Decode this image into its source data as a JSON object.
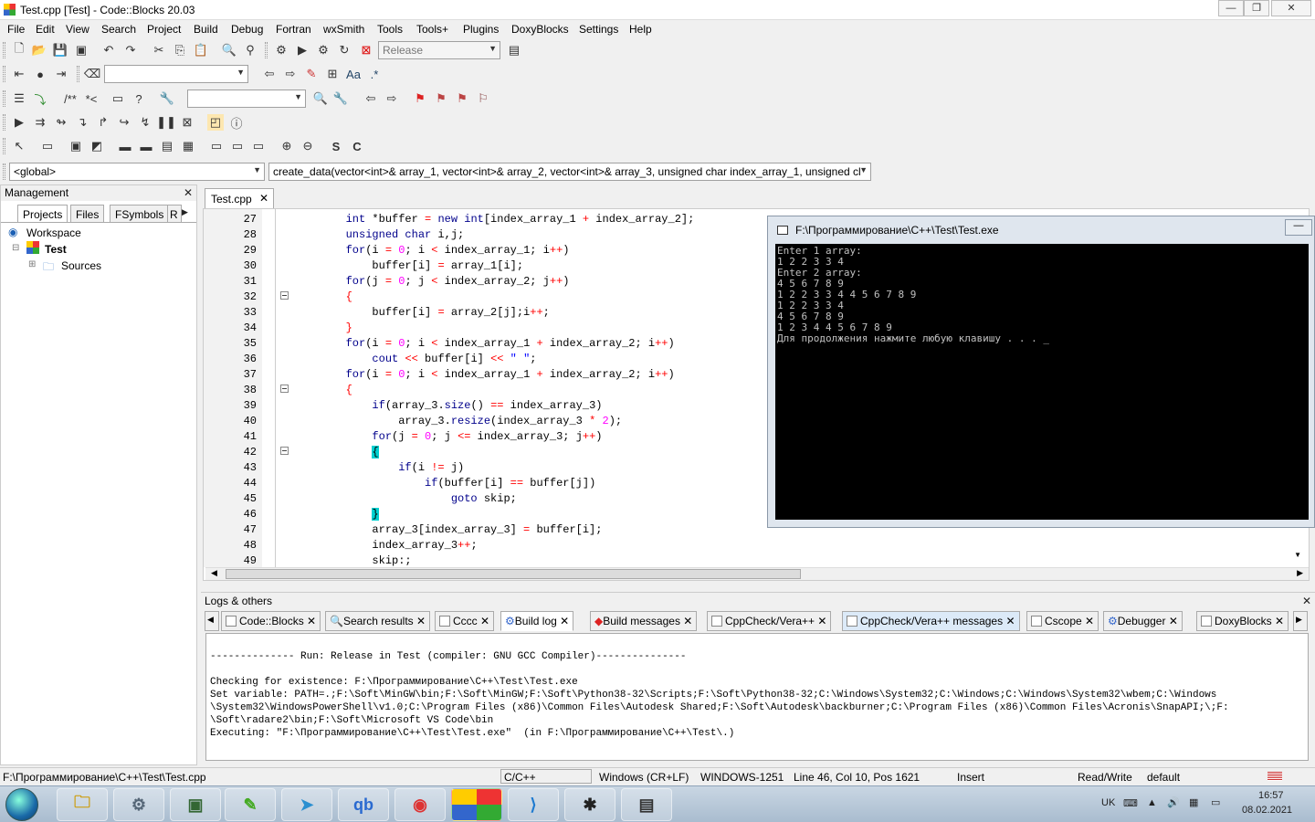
{
  "window": {
    "title": "Test.cpp [Test] - Code::Blocks 20.03",
    "min": "—",
    "max": "❐",
    "close": "✕"
  },
  "menu": [
    "File",
    "Edit",
    "View",
    "Search",
    "Project",
    "Build",
    "Debug",
    "Fortran",
    "wxSmith",
    "Tools",
    "Tools+",
    "Plugins",
    "DoxyBlocks",
    "Settings",
    "Help"
  ],
  "toolbar": {
    "build_target": "Release",
    "scope": "<global>",
    "function": "create_data(vector<int>& array_1, vector<int>& array_2, vector<int>& array_3, unsigned char index_array_1, unsigned cl"
  },
  "management": {
    "title": "Management",
    "tabs": [
      "Projects",
      "Files",
      "FSymbols",
      "R"
    ],
    "tree": {
      "workspace": "Workspace",
      "project": "Test",
      "folder": "Sources"
    }
  },
  "editor": {
    "tab": "Test.cpp",
    "lines": [
      {
        "n": "27",
        "html": "        <span class='kw'>int</span> *buffer <span class='op'>=</span> <span class='kw'>new</span> <span class='kw'>int</span>[index_array_1 <span class='op'>+</span> index_array_2];"
      },
      {
        "n": "28",
        "html": "        <span class='kw'>unsigned</span> <span class='kw'>char</span> i,j;"
      },
      {
        "n": "29",
        "html": "        <span class='kw'>for</span>(i <span class='op'>=</span> <span class='nm'>0</span>; i <span class='op'>&lt;</span> index_array_1; i<span class='op'>++</span>)"
      },
      {
        "n": "30",
        "html": "            buffer[i] <span class='op'>=</span> array_1[i];"
      },
      {
        "n": "31",
        "html": "        <span class='kw'>for</span>(j <span class='op'>=</span> <span class='nm'>0</span>; j <span class='op'>&lt;</span> index_array_2; j<span class='op'>++</span>)"
      },
      {
        "n": "32",
        "html": "        <span class='op'>{</span>"
      },
      {
        "n": "33",
        "html": "            buffer[i] <span class='op'>=</span> array_2[j];i<span class='op'>++</span>;"
      },
      {
        "n": "34",
        "html": "        <span class='op'>}</span>"
      },
      {
        "n": "35",
        "html": "        <span class='kw'>for</span>(i <span class='op'>=</span> <span class='nm'>0</span>; i <span class='op'>&lt;</span> index_array_1 <span class='op'>+</span> index_array_2; i<span class='op'>++</span>)"
      },
      {
        "n": "36",
        "html": "            <span class='kw'>cout</span> <span class='op'>&lt;&lt;</span> buffer[i] <span class='op'>&lt;&lt;</span> <span class='str'>\" \"</span>;"
      },
      {
        "n": "37",
        "html": "        <span class='kw'>for</span>(i <span class='op'>=</span> <span class='nm'>0</span>; i <span class='op'>&lt;</span> index_array_1 <span class='op'>+</span> index_array_2; i<span class='op'>++</span>)"
      },
      {
        "n": "38",
        "html": "        <span class='op'>{</span>"
      },
      {
        "n": "39",
        "html": "            <span class='kw'>if</span>(array_3.<span class='kw'>size</span>() <span class='op'>==</span> index_array_3)"
      },
      {
        "n": "40",
        "html": "                array_3.<span class='kw'>resize</span>(index_array_3 <span class='op'>*</span> <span class='nm'>2</span>);"
      },
      {
        "n": "41",
        "html": "            <span class='kw'>for</span>(j <span class='op'>=</span> <span class='nm'>0</span>; j <span class='op'>&lt;=</span> index_array_3; j<span class='op'>++</span>)"
      },
      {
        "n": "42",
        "html": "            <span class='hbrace'>{</span>"
      },
      {
        "n": "43",
        "html": "                <span class='kw'>if</span>(i <span class='op'>!=</span> j)"
      },
      {
        "n": "44",
        "html": "                    <span class='kw'>if</span>(buffer[i] <span class='op'>==</span> buffer[j])"
      },
      {
        "n": "45",
        "html": "                        <span class='kw'>goto</span> skip;"
      },
      {
        "n": "46",
        "html": "            <span class='hbrace'>}</span>"
      },
      {
        "n": "47",
        "html": "            array_3[index_array_3] <span class='op'>=</span> buffer[i];"
      },
      {
        "n": "48",
        "html": "            index_array_3<span class='op'>++</span>;"
      },
      {
        "n": "49",
        "html": "            skip:;"
      }
    ]
  },
  "console": {
    "title": "F:\\Программирование\\C++\\Test\\Test.exe",
    "text": "Enter 1 array:\n1 2 2 3 3 4\nEnter 2 array:\n4 5 6 7 8 9\n1 2 2 3 3 4 4 5 6 7 8 9\n1 2 2 3 3 4\n4 5 6 7 8 9\n1 2 3 4 4 5 6 7 8 9\nДля продолжения нажмите любую клавишу . . . _"
  },
  "logs": {
    "title": "Logs & others",
    "tabs": [
      "Code::Blocks",
      "Search results",
      "Cccc",
      "Build log",
      "Build messages",
      "CppCheck/Vera++",
      "CppCheck/Vera++ messages",
      "Cscope",
      "Debugger",
      "DoxyBlocks"
    ],
    "text": "\n-------------- Run: Release in Test (compiler: GNU GCC Compiler)---------------\n\nChecking for existence: F:\\Программирование\\C++\\Test\\Test.exe\nSet variable: PATH=.;F:\\Soft\\MinGW\\bin;F:\\Soft\\MinGW;F:\\Soft\\Python38-32\\Scripts;F:\\Soft\\Python38-32;C:\\Windows\\System32;C:\\Windows;C:\\Windows\\System32\\wbem;C:\\Windows\n\\System32\\WindowsPowerShell\\v1.0;C:\\Program Files (x86)\\Common Files\\Autodesk Shared;F:\\Soft\\Autodesk\\backburner;C:\\Program Files (x86)\\Common Files\\Acronis\\SnapAPI;\\;F:\n\\Soft\\radare2\\bin;F:\\Soft\\Microsoft VS Code\\bin\nExecuting: \"F:\\Программирование\\C++\\Test\\Test.exe\"  (in F:\\Программирование\\C++\\Test\\.)"
  },
  "status": {
    "path": "F:\\Программирование\\C++\\Test\\Test.cpp",
    "lang": "C/C++",
    "eol": "Windows (CR+LF)",
    "enc": "WINDOWS-1251",
    "pos": "Line 46, Col 10, Pos 1621",
    "mode": "Insert",
    "rw": "Read/Write",
    "profile": "default"
  },
  "taskbar": {
    "lang": "UK",
    "time": "16:57",
    "date": "08.02.2021",
    "qb": "qb"
  }
}
